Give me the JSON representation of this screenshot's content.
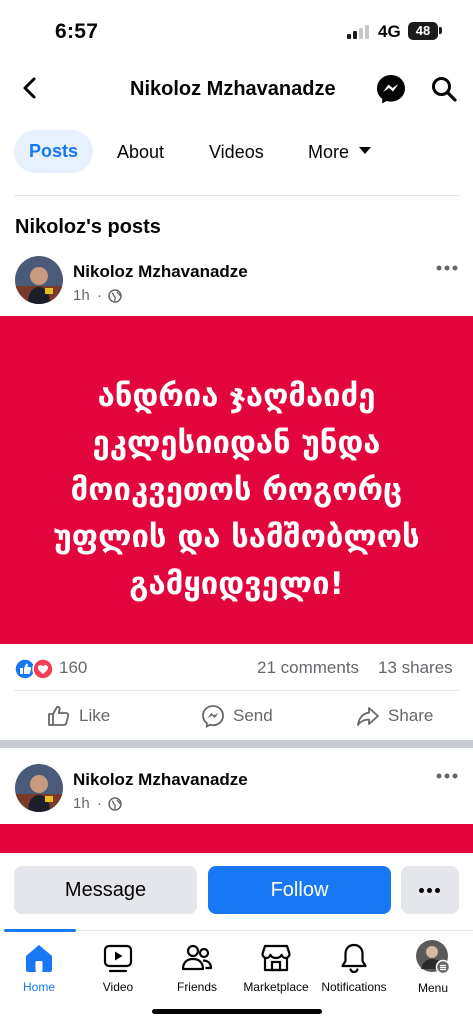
{
  "status_bar": {
    "time": "6:57",
    "network": "4G",
    "battery": "48"
  },
  "header": {
    "title": "Nikoloz Mzhavanadze"
  },
  "tabs": [
    {
      "label": "Posts",
      "active": true
    },
    {
      "label": "About"
    },
    {
      "label": "Videos"
    },
    {
      "label": "More"
    }
  ],
  "section_title": "Nikoloz's posts",
  "posts": [
    {
      "author": "Nikoloz Mzhavanadze",
      "time": "1h",
      "banner_lines": [
        "ანდრია ჯაღმაიძე",
        "ეკლესიიდან უნდა",
        "მოიკვეთოს როგორც",
        "უფლის და სამშობლოს",
        "გამყიდველი!"
      ],
      "banner_color": "#e3063d",
      "reaction_count": "160",
      "comments": "21 comments",
      "shares": "13 shares",
      "actions": {
        "like": "Like",
        "send": "Send",
        "share": "Share"
      }
    },
    {
      "author": "Nikoloz Mzhavanadze",
      "time": "1h"
    }
  ],
  "profile_actions": {
    "message": "Message",
    "follow": "Follow"
  },
  "bottom_nav": [
    {
      "label": "Home",
      "icon": "home-icon",
      "active": true
    },
    {
      "label": "Video",
      "icon": "video-icon"
    },
    {
      "label": "Friends",
      "icon": "friends-icon"
    },
    {
      "label": "Marketplace",
      "icon": "marketplace-icon"
    },
    {
      "label": "Notifications",
      "icon": "bell-icon"
    },
    {
      "label": "Menu",
      "icon": "menu-avatar-icon"
    }
  ],
  "colors": {
    "brand_blue": "#1877f2",
    "secondary_text": "#65676b",
    "button_gray": "#e4e6eb"
  }
}
